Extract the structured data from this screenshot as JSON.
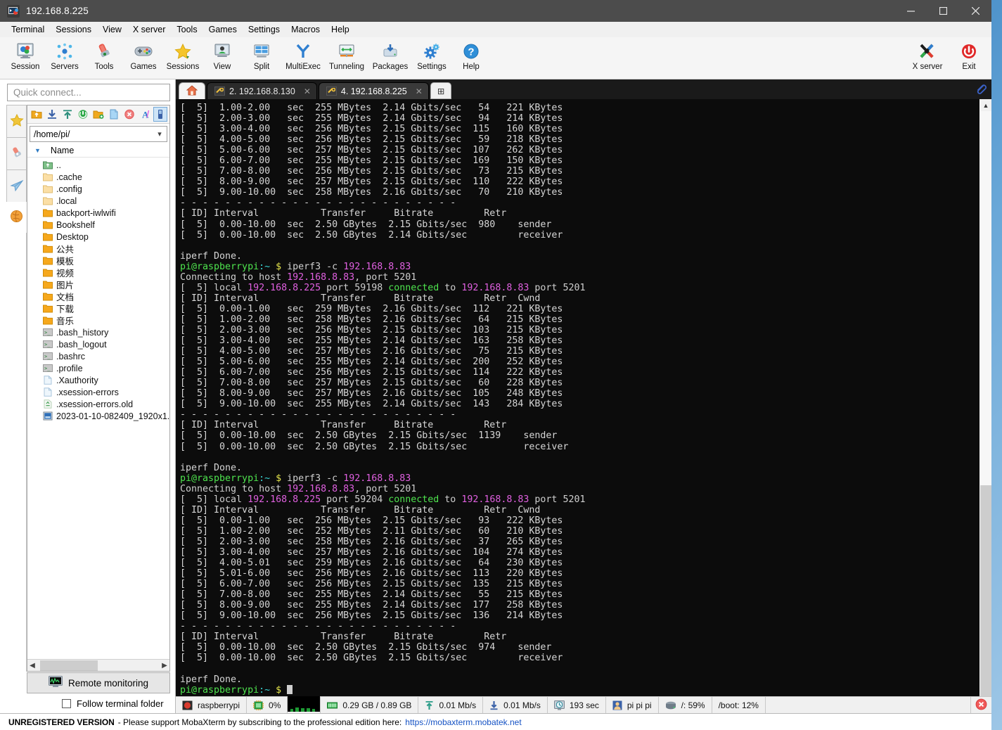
{
  "window": {
    "title": "192.168.8.225",
    "controls": {
      "minimize": "─",
      "maximize": "☐",
      "close": "✕"
    }
  },
  "menubar": [
    "Terminal",
    "Sessions",
    "View",
    "X server",
    "Tools",
    "Games",
    "Settings",
    "Macros",
    "Help"
  ],
  "toolbar": {
    "left": [
      {
        "label": "Session",
        "icon": "session-icon"
      },
      {
        "label": "Servers",
        "icon": "servers-icon"
      },
      {
        "label": "Tools",
        "icon": "tools-icon"
      },
      {
        "label": "Games",
        "icon": "games-icon"
      },
      {
        "label": "Sessions",
        "icon": "sessions-star-icon"
      },
      {
        "label": "View",
        "icon": "view-icon"
      },
      {
        "label": "Split",
        "icon": "split-icon"
      },
      {
        "label": "MultiExec",
        "icon": "multiexec-icon"
      },
      {
        "label": "Tunneling",
        "icon": "tunneling-icon"
      },
      {
        "label": "Packages",
        "icon": "packages-icon"
      },
      {
        "label": "Settings",
        "icon": "settings-gear-icon"
      },
      {
        "label": "Help",
        "icon": "help-icon"
      }
    ],
    "right": [
      {
        "label": "X server",
        "icon": "xserver-icon"
      },
      {
        "label": "Exit",
        "icon": "exit-power-icon"
      }
    ]
  },
  "sidebar": {
    "quick_connect_placeholder": "Quick connect...",
    "tabs": [
      {
        "name": "sessions-star",
        "icon": "star-icon"
      },
      {
        "name": "tools-knife",
        "icon": "swiss-knife-icon"
      },
      {
        "name": "macros-plane",
        "icon": "paper-plane-icon"
      },
      {
        "name": "sftp-globe",
        "icon": "globe-icon"
      }
    ],
    "file_panel": {
      "buttons": [
        "up-folder-icon",
        "download-icon",
        "upload-icon",
        "refresh-icon",
        "new-folder-icon",
        "new-file-icon",
        "delete-icon",
        "text-mode-icon",
        "usb-icon"
      ],
      "path": "/home/pi/",
      "column_header": "Name",
      "files": [
        {
          "name": "..",
          "type": "up"
        },
        {
          "name": ".cache",
          "type": "folder-light"
        },
        {
          "name": ".config",
          "type": "folder-light"
        },
        {
          "name": ".local",
          "type": "folder-light"
        },
        {
          "name": "backport-iwlwifi",
          "type": "folder"
        },
        {
          "name": "Bookshelf",
          "type": "folder"
        },
        {
          "name": "Desktop",
          "type": "folder"
        },
        {
          "name": "公共",
          "type": "folder"
        },
        {
          "name": "模板",
          "type": "folder"
        },
        {
          "name": "视频",
          "type": "folder"
        },
        {
          "name": "图片",
          "type": "folder"
        },
        {
          "name": "文档",
          "type": "folder"
        },
        {
          "name": "下载",
          "type": "folder"
        },
        {
          "name": "音乐",
          "type": "folder"
        },
        {
          "name": ".bash_history",
          "type": "script"
        },
        {
          "name": ".bash_logout",
          "type": "script"
        },
        {
          "name": ".bashrc",
          "type": "script"
        },
        {
          "name": ".profile",
          "type": "script"
        },
        {
          "name": ".Xauthority",
          "type": "file"
        },
        {
          "name": ".xsession-errors",
          "type": "file"
        },
        {
          "name": ".xsession-errors.old",
          "type": "recycle"
        },
        {
          "name": "2023-01-10-082409_1920x1...",
          "type": "image"
        }
      ]
    },
    "remote_monitoring_label": "Remote monitoring",
    "follow_terminal_folder_label": "Follow terminal folder",
    "follow_terminal_folder_checked": false
  },
  "tabs": [
    {
      "label": "",
      "type": "home",
      "icon": "home-icon",
      "active": false
    },
    {
      "label": "2. 192.168.8.130",
      "type": "session",
      "icon": "terminal-key-icon",
      "active": false,
      "close": "✕"
    },
    {
      "label": "4. 192.168.8.225",
      "type": "session",
      "icon": "terminal-key-icon",
      "active": true,
      "close": "✕"
    },
    {
      "label": "⊞",
      "type": "new",
      "icon": "plus-icon",
      "active": false
    }
  ],
  "terminal": {
    "prompt_user": "pi@raspberrypi",
    "prompt_host_sep": ":~",
    "prompt_symbol": "$",
    "command": "iperf3 -c 192.168.8.83",
    "local_ip": "192.168.8.225",
    "remote_ip": "192.168.8.83",
    "port": "5201",
    "headers": {
      "with_cwnd": "[ ID] Interval           Transfer     Bitrate         Retr  Cwnd",
      "no_cwnd": "[ ID] Interval           Transfer     Bitrate         Retr"
    },
    "separator": "- - - - - - - - - - - - - - - - - - - - - - - - -",
    "done_text": "iperf Done.",
    "connecting_prefix": "Connecting to host ",
    "connecting_suffix": ", port 5201",
    "runs": [
      {
        "partial": true,
        "local_port": "",
        "intervals": [
          {
            "id": "5",
            "interval": "1.00-2.00",
            "transfer": "255 MBytes",
            "bitrate": "2.14 Gbits/sec",
            "retr": "54",
            "cwnd": "221 KBytes"
          },
          {
            "id": "5",
            "interval": "2.00-3.00",
            "transfer": "255 MBytes",
            "bitrate": "2.14 Gbits/sec",
            "retr": "94",
            "cwnd": "214 KBytes"
          },
          {
            "id": "5",
            "interval": "3.00-4.00",
            "transfer": "256 MBytes",
            "bitrate": "2.15 Gbits/sec",
            "retr": "115",
            "cwnd": "160 KBytes"
          },
          {
            "id": "5",
            "interval": "4.00-5.00",
            "transfer": "256 MBytes",
            "bitrate": "2.15 Gbits/sec",
            "retr": "59",
            "cwnd": "218 KBytes"
          },
          {
            "id": "5",
            "interval": "5.00-6.00",
            "transfer": "257 MBytes",
            "bitrate": "2.15 Gbits/sec",
            "retr": "107",
            "cwnd": "262 KBytes"
          },
          {
            "id": "5",
            "interval": "6.00-7.00",
            "transfer": "255 MBytes",
            "bitrate": "2.15 Gbits/sec",
            "retr": "169",
            "cwnd": "150 KBytes"
          },
          {
            "id": "5",
            "interval": "7.00-8.00",
            "transfer": "256 MBytes",
            "bitrate": "2.15 Gbits/sec",
            "retr": "73",
            "cwnd": "215 KBytes"
          },
          {
            "id": "5",
            "interval": "8.00-9.00",
            "transfer": "257 MBytes",
            "bitrate": "2.15 Gbits/sec",
            "retr": "110",
            "cwnd": "222 KBytes"
          },
          {
            "id": "5",
            "interval": "9.00-10.00",
            "transfer": "258 MBytes",
            "bitrate": "2.16 Gbits/sec",
            "retr": "70",
            "cwnd": "210 KBytes"
          }
        ],
        "summary": {
          "sender": {
            "id": "5",
            "interval": "0.00-10.00",
            "transfer": "2.50 GBytes",
            "bitrate": "2.15 Gbits/sec",
            "retr": "980",
            "role": "sender"
          },
          "receiver": {
            "id": "5",
            "interval": "0.00-10.00",
            "transfer": "2.50 GBytes",
            "bitrate": "2.14 Gbits/sec",
            "retr": "",
            "role": "receiver"
          }
        }
      },
      {
        "partial": false,
        "local_port": "59198",
        "intervals": [
          {
            "id": "5",
            "interval": "0.00-1.00",
            "transfer": "259 MBytes",
            "bitrate": "2.16 Gbits/sec",
            "retr": "112",
            "cwnd": "221 KBytes"
          },
          {
            "id": "5",
            "interval": "1.00-2.00",
            "transfer": "258 MBytes",
            "bitrate": "2.16 Gbits/sec",
            "retr": "64",
            "cwnd": "215 KBytes"
          },
          {
            "id": "5",
            "interval": "2.00-3.00",
            "transfer": "256 MBytes",
            "bitrate": "2.15 Gbits/sec",
            "retr": "103",
            "cwnd": "215 KBytes"
          },
          {
            "id": "5",
            "interval": "3.00-4.00",
            "transfer": "255 MBytes",
            "bitrate": "2.14 Gbits/sec",
            "retr": "163",
            "cwnd": "258 KBytes"
          },
          {
            "id": "5",
            "interval": "4.00-5.00",
            "transfer": "257 MBytes",
            "bitrate": "2.16 Gbits/sec",
            "retr": "75",
            "cwnd": "215 KBytes"
          },
          {
            "id": "5",
            "interval": "5.00-6.00",
            "transfer": "255 MBytes",
            "bitrate": "2.14 Gbits/sec",
            "retr": "200",
            "cwnd": "252 KBytes"
          },
          {
            "id": "5",
            "interval": "6.00-7.00",
            "transfer": "256 MBytes",
            "bitrate": "2.15 Gbits/sec",
            "retr": "114",
            "cwnd": "222 KBytes"
          },
          {
            "id": "5",
            "interval": "7.00-8.00",
            "transfer": "257 MBytes",
            "bitrate": "2.15 Gbits/sec",
            "retr": "60",
            "cwnd": "228 KBytes"
          },
          {
            "id": "5",
            "interval": "8.00-9.00",
            "transfer": "257 MBytes",
            "bitrate": "2.16 Gbits/sec",
            "retr": "105",
            "cwnd": "248 KBytes"
          },
          {
            "id": "5",
            "interval": "9.00-10.00",
            "transfer": "255 MBytes",
            "bitrate": "2.14 Gbits/sec",
            "retr": "143",
            "cwnd": "284 KBytes"
          }
        ],
        "summary": {
          "sender": {
            "id": "5",
            "interval": "0.00-10.00",
            "transfer": "2.50 GBytes",
            "bitrate": "2.15 Gbits/sec",
            "retr": "1139",
            "role": "sender"
          },
          "receiver": {
            "id": "5",
            "interval": "0.00-10.00",
            "transfer": "2.50 GBytes",
            "bitrate": "2.15 Gbits/sec",
            "retr": "",
            "role": "receiver"
          }
        }
      },
      {
        "partial": false,
        "local_port": "59204",
        "intervals": [
          {
            "id": "5",
            "interval": "0.00-1.00",
            "transfer": "256 MBytes",
            "bitrate": "2.15 Gbits/sec",
            "retr": "93",
            "cwnd": "222 KBytes"
          },
          {
            "id": "5",
            "interval": "1.00-2.00",
            "transfer": "252 MBytes",
            "bitrate": "2.11 Gbits/sec",
            "retr": "60",
            "cwnd": "210 KBytes"
          },
          {
            "id": "5",
            "interval": "2.00-3.00",
            "transfer": "258 MBytes",
            "bitrate": "2.16 Gbits/sec",
            "retr": "37",
            "cwnd": "265 KBytes"
          },
          {
            "id": "5",
            "interval": "3.00-4.00",
            "transfer": "257 MBytes",
            "bitrate": "2.16 Gbits/sec",
            "retr": "104",
            "cwnd": "274 KBytes"
          },
          {
            "id": "5",
            "interval": "4.00-5.01",
            "transfer": "259 MBytes",
            "bitrate": "2.16 Gbits/sec",
            "retr": "64",
            "cwnd": "230 KBytes"
          },
          {
            "id": "5",
            "interval": "5.01-6.00",
            "transfer": "256 MBytes",
            "bitrate": "2.16 Gbits/sec",
            "retr": "113",
            "cwnd": "220 KBytes"
          },
          {
            "id": "5",
            "interval": "6.00-7.00",
            "transfer": "256 MBytes",
            "bitrate": "2.15 Gbits/sec",
            "retr": "135",
            "cwnd": "215 KBytes"
          },
          {
            "id": "5",
            "interval": "7.00-8.00",
            "transfer": "255 MBytes",
            "bitrate": "2.14 Gbits/sec",
            "retr": "55",
            "cwnd": "215 KBytes"
          },
          {
            "id": "5",
            "interval": "8.00-9.00",
            "transfer": "255 MBytes",
            "bitrate": "2.14 Gbits/sec",
            "retr": "177",
            "cwnd": "258 KBytes"
          },
          {
            "id": "5",
            "interval": "9.00-10.00",
            "transfer": "256 MBytes",
            "bitrate": "2.15 Gbits/sec",
            "retr": "136",
            "cwnd": "214 KBytes"
          }
        ],
        "summary": {
          "sender": {
            "id": "5",
            "interval": "0.00-10.00",
            "transfer": "2.50 GBytes",
            "bitrate": "2.15 Gbits/sec",
            "retr": "974",
            "role": "sender"
          },
          "receiver": {
            "id": "5",
            "interval": "0.00-10.00",
            "transfer": "2.50 GBytes",
            "bitrate": "2.15 Gbits/sec",
            "retr": "",
            "role": "receiver"
          }
        }
      }
    ]
  },
  "statusbar": [
    {
      "name": "hostname",
      "icon": "raspberry-icon",
      "text": "raspberrypi"
    },
    {
      "name": "cpu",
      "icon": "cpu-icon",
      "text": "0%"
    },
    {
      "name": "cpu-graph",
      "icon": "cpu-graph",
      "text": ""
    },
    {
      "name": "memory",
      "icon": "ram-icon",
      "text": "0.29 GB / 0.89 GB"
    },
    {
      "name": "upload-rate",
      "icon": "upload-icon",
      "text": "0.01 Mb/s"
    },
    {
      "name": "download-rate",
      "icon": "download-icon",
      "text": "0.01 Mb/s"
    },
    {
      "name": "uptime",
      "icon": "clock-icon",
      "text": "193 sec"
    },
    {
      "name": "users",
      "icon": "user-icon",
      "text": "pi  pi  pi"
    },
    {
      "name": "disk-root",
      "icon": "disk-icon",
      "text": "/: 59%"
    },
    {
      "name": "disk-boot",
      "icon": "",
      "text": "/boot: 12%"
    }
  ],
  "nagbar": {
    "bold": "UNREGISTERED VERSION",
    "text": "- Please support MobaXterm by subscribing to the professional edition here:",
    "link": "https://mobaxterm.mobatek.net"
  },
  "colors": {
    "terminal_bg": "#0c0c0c",
    "prompt_green": "#4ee44e",
    "ip_magenta": "#e060e0",
    "connected_green": "#4ee44e",
    "titlebar": "#4c4c4c",
    "accent_blue": "#1552c4"
  }
}
